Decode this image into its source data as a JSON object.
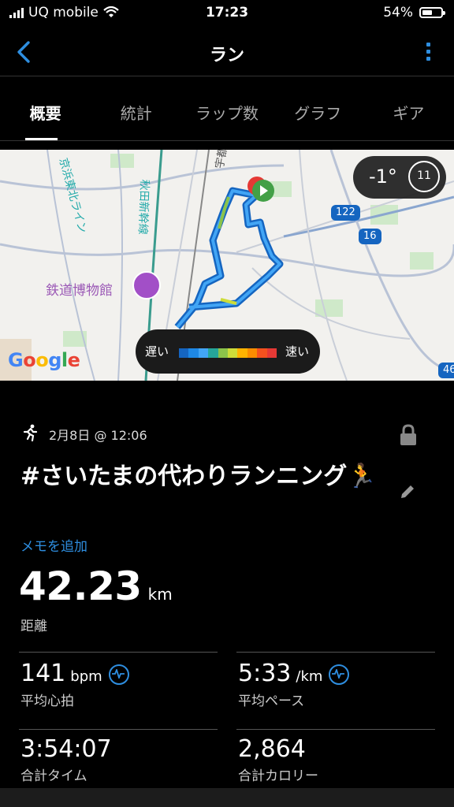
{
  "status": {
    "carrier": "UQ mobile",
    "time": "17:23",
    "battery": "54%"
  },
  "nav": {
    "title": "ラン"
  },
  "tabs": [
    {
      "label": "概要"
    },
    {
      "label": "統計"
    },
    {
      "label": "ラップ数"
    },
    {
      "label": "グラフ"
    },
    {
      "label": "ギア"
    }
  ],
  "map": {
    "temperature": "-1°",
    "wind_number": "11",
    "legend": {
      "slow": "遅い",
      "fast": "速い",
      "colors": [
        "#1565c0",
        "#1e88e5",
        "#42a5f5",
        "#26a69a",
        "#8bc34a",
        "#cddc39",
        "#ffb300",
        "#fb8c00",
        "#f4511e",
        "#e53935"
      ]
    },
    "poi": "鉄道博物館",
    "rail_labels": {
      "akita": "秋田新幹線",
      "utsunomiya": "宇都宮線",
      "keihin": "京浜東北ライン"
    },
    "roads": [
      "122",
      "16",
      "46"
    ],
    "attribution": "Google"
  },
  "activity": {
    "date": "2月8日 @ 12:06",
    "title": "#さいたまの代わりランニング🏃",
    "add_memo": "メモを追加",
    "distance": {
      "value": "42.23",
      "unit": "km",
      "label": "距離"
    },
    "stats": [
      {
        "value": "141",
        "unit": "bpm",
        "label": "平均心拍"
      },
      {
        "value": "5:33",
        "unit": "/km",
        "label": "平均ペース"
      },
      {
        "value": "3:54:07",
        "unit": "",
        "label": "合計タイム"
      },
      {
        "value": "2,864",
        "unit": "",
        "label": "合計カロリー"
      }
    ]
  }
}
